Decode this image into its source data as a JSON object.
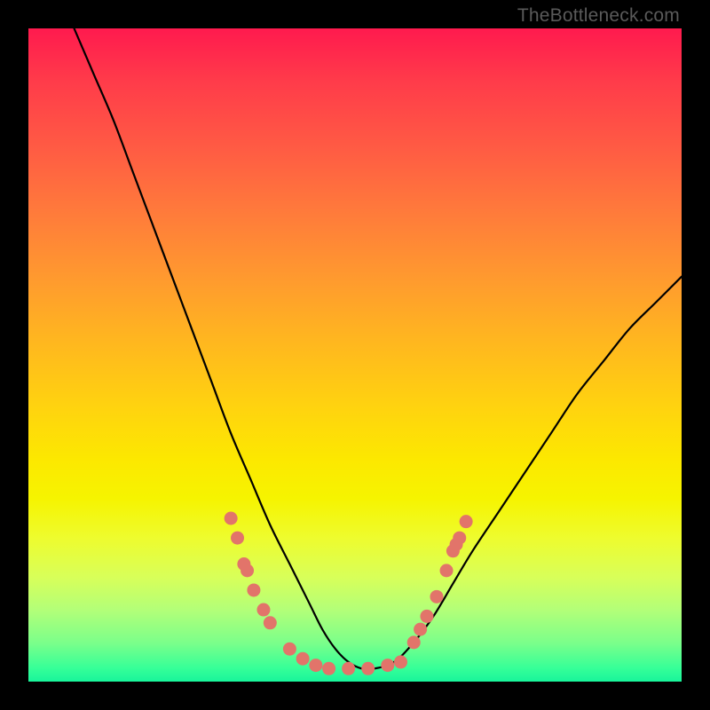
{
  "watermark": "TheBottleneck.com",
  "chart_data": {
    "type": "line",
    "title": "",
    "xlabel": "",
    "ylabel": "",
    "xlim": [
      0,
      100
    ],
    "ylim": [
      0,
      100
    ],
    "grid": false,
    "series": [
      {
        "name": "bottleneck-curve",
        "color": "#000000",
        "x": [
          7,
          10,
          13,
          16,
          19,
          22,
          25,
          28,
          31,
          34,
          37,
          40,
          43,
          45,
          47,
          49,
          51,
          53,
          56,
          59,
          62,
          65,
          68,
          72,
          76,
          80,
          84,
          88,
          92,
          96,
          100
        ],
        "y": [
          100,
          93,
          86,
          78,
          70,
          62,
          54,
          46,
          38,
          31,
          24,
          18,
          12,
          8,
          5,
          3,
          2,
          2,
          3,
          6,
          10,
          15,
          20,
          26,
          32,
          38,
          44,
          49,
          54,
          58,
          62
        ]
      }
    ],
    "markers": {
      "name": "highlight-dots",
      "color": "#e2746a",
      "points": [
        {
          "x": 31,
          "y": 25
        },
        {
          "x": 32,
          "y": 22
        },
        {
          "x": 33,
          "y": 18
        },
        {
          "x": 33.5,
          "y": 17
        },
        {
          "x": 34.5,
          "y": 14
        },
        {
          "x": 36,
          "y": 11
        },
        {
          "x": 37,
          "y": 9
        },
        {
          "x": 40,
          "y": 5
        },
        {
          "x": 42,
          "y": 3.5
        },
        {
          "x": 44,
          "y": 2.5
        },
        {
          "x": 46,
          "y": 2
        },
        {
          "x": 49,
          "y": 2
        },
        {
          "x": 52,
          "y": 2
        },
        {
          "x": 55,
          "y": 2.5
        },
        {
          "x": 57,
          "y": 3
        },
        {
          "x": 59,
          "y": 6
        },
        {
          "x": 60,
          "y": 8
        },
        {
          "x": 61,
          "y": 10
        },
        {
          "x": 62.5,
          "y": 13
        },
        {
          "x": 64,
          "y": 17
        },
        {
          "x": 65,
          "y": 20
        },
        {
          "x": 65.5,
          "y": 21
        },
        {
          "x": 66,
          "y": 22
        },
        {
          "x": 67,
          "y": 24.5
        }
      ]
    }
  }
}
